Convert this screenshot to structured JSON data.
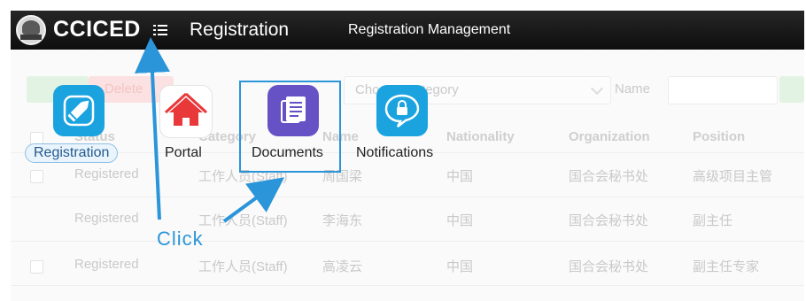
{
  "topbar": {
    "logo_text": "CCICED",
    "logo_emblem_text": "CCICED",
    "app_title": "Registration",
    "subtitle": "Registration Management"
  },
  "background": {
    "buttons": [
      "Delete"
    ],
    "select_placeholder": "Choose Category",
    "filter_label": "Name",
    "columns": [
      "Status",
      "Category",
      "Name",
      "Nationality",
      "Organization",
      "Position"
    ],
    "rows": [
      [
        "Registered",
        "工作人员(Staff)",
        "周国梁",
        "中国",
        "国合会秘书处",
        "高级项目主管"
      ],
      [
        "Registered",
        "工作人员(Staff)",
        "李海东",
        "中国",
        "国合会秘书处",
        "副主任"
      ],
      [
        "Registered",
        "工作人员(Staff)",
        "高凌云",
        "中国",
        "国合会秘书处",
        "副主任专家"
      ]
    ]
  },
  "launcher": {
    "items": [
      {
        "label": "Registration",
        "icon": "pencil-icon",
        "color": "#1ba3df"
      },
      {
        "label": "Portal",
        "icon": "home-icon",
        "color": "#e8383a"
      },
      {
        "label": "Documents",
        "icon": "documents-icon",
        "color": "#6652c5"
      },
      {
        "label": "Notifications",
        "icon": "chat-lock-icon",
        "color": "#1ba3df"
      }
    ]
  },
  "annotation": {
    "label": "Click",
    "color": "#2b95d9"
  }
}
